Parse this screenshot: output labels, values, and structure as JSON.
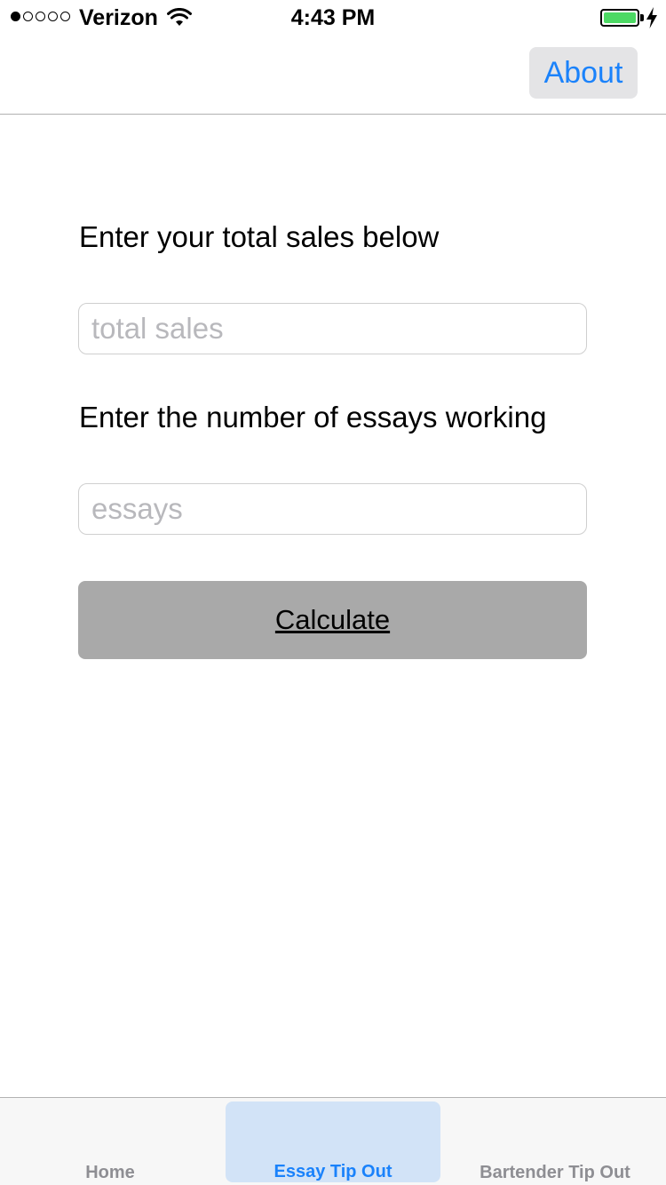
{
  "status_bar": {
    "carrier": "Verizon",
    "time": "4:43 PM",
    "signal_bars_filled": 1,
    "signal_bars_total": 5,
    "battery_color": "#4cd964",
    "icons": [
      "wifi-icon",
      "battery-icon",
      "charging-bolt-icon"
    ]
  },
  "nav": {
    "about_label": "About"
  },
  "form": {
    "sales_label": "Enter your total sales below",
    "sales_placeholder": "total sales",
    "sales_value": "",
    "essays_label": "Enter the number of essays working",
    "essays_placeholder": "essays",
    "essays_value": "",
    "calculate_label": "Calculate"
  },
  "tabs": [
    {
      "label": "Home",
      "selected": false
    },
    {
      "label": "Essay Tip Out",
      "selected": true
    },
    {
      "label": "Bartender Tip Out",
      "selected": false
    }
  ],
  "colors": {
    "accent": "#1a82fb",
    "selected_tab_bg": "#d2e3f7",
    "button_gray": "#a9a9a9"
  }
}
